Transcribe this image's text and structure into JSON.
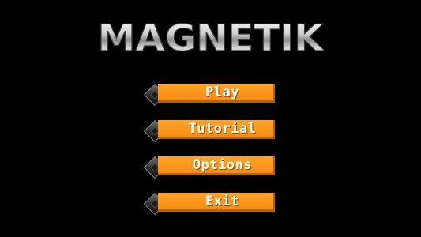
{
  "title": "MAGNETIK",
  "menu": {
    "items": [
      {
        "label": "Play"
      },
      {
        "label": "Tutorial"
      },
      {
        "label": "Options"
      },
      {
        "label": "Exit"
      }
    ]
  },
  "colors": {
    "background": "#000000",
    "button": "#f7941d",
    "button_shadow": "#b8600a",
    "button_text": "#ffffff",
    "logo_light": "#e8e8e8",
    "logo_dark": "#7a7a7a"
  },
  "icons": {
    "bullet": "diamond-bullet-icon"
  }
}
